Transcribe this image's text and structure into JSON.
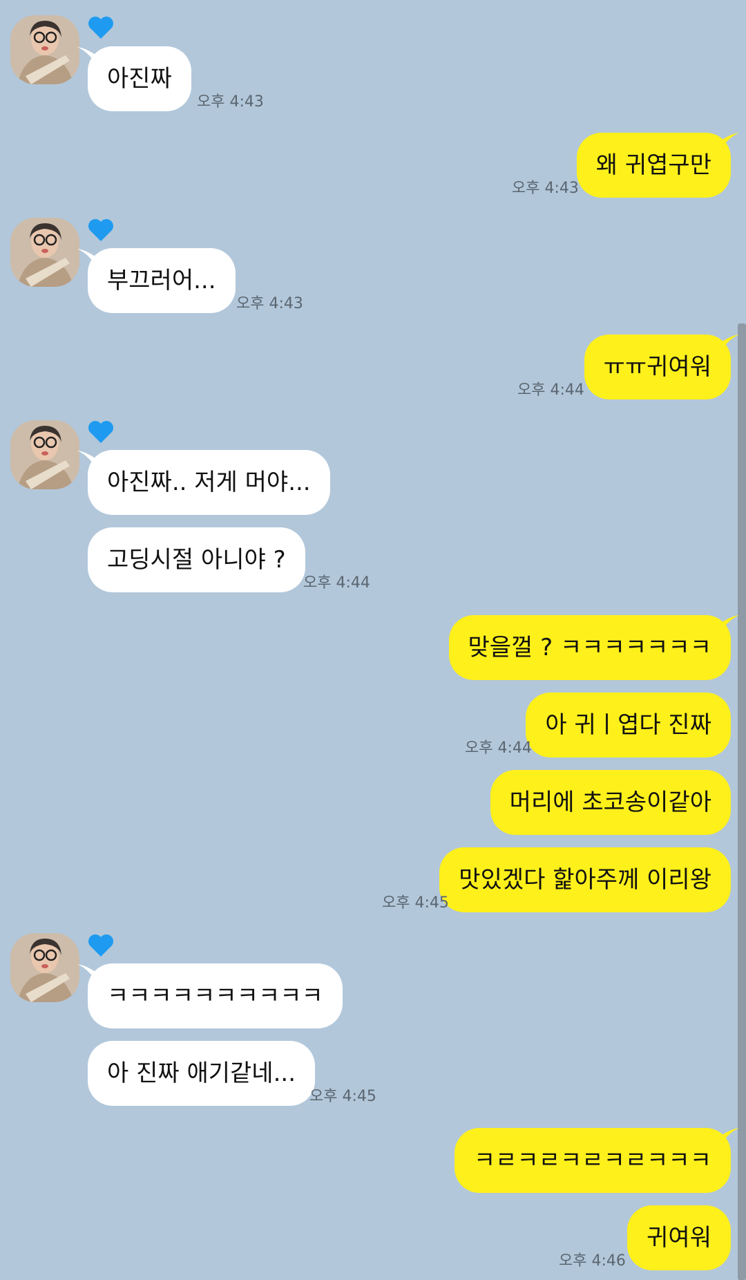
{
  "colors": {
    "background": "#b2c7da",
    "incoming_bubble": "#ffffff",
    "outgoing_bubble": "#fef01b",
    "heart": "#1e9bf0"
  },
  "messages": {
    "m1": "아진짜",
    "t1": "오후 4:43",
    "m2": "왜 귀엽구만",
    "t2": "오후 4:43",
    "m3": "부끄러어...",
    "t3": "오후 4:43",
    "m4": "ㅠㅠ귀여워",
    "t4": "오후 4:44",
    "m5": "아진짜.. 저게 머야...",
    "m6": "고딩시절 아니야 ?",
    "t6": "오후 4:44",
    "m7": "맞을껄 ? ㅋㅋㅋㅋㅋㅋㅋ",
    "m8": "아 귀ㅣ엽다 진짜",
    "t8": "오후 4:44",
    "m9": "머리에 초코송이같아",
    "m10": "맛있겠다 핥아주께 이리왕",
    "t10": "오후 4:45",
    "m11": "ㅋㅋㅋㅋㅋㅋㅋㅋㅋㅋ",
    "m12": "아 진짜 애기같네...",
    "t12": "오후 4:45",
    "m13": "ㅋㄹㅋㄹㅋㄹㅋㄹㅋㅋㅋ",
    "m14": "귀여워",
    "t14": "오후 4:46"
  }
}
